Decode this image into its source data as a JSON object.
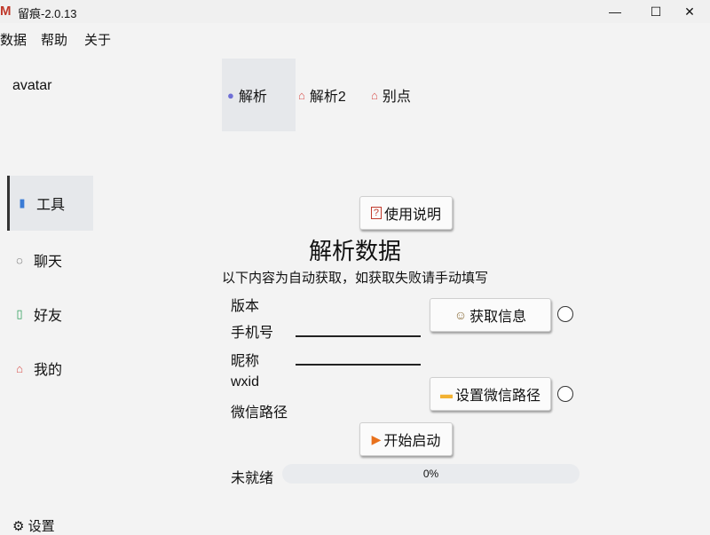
{
  "window": {
    "app_icon": "M",
    "title": "留痕-2.0.13",
    "minimize": "—",
    "maximize": "☐",
    "close": "✕"
  },
  "menu": [
    "数据",
    "帮助",
    "关于"
  ],
  "sidebar": {
    "avatar": "avatar",
    "items": [
      {
        "label": "工具",
        "icon": "tools-icon",
        "glyph": "▮"
      },
      {
        "label": "聊天",
        "icon": "chat-icon",
        "glyph": "◌"
      },
      {
        "label": "好友",
        "icon": "contacts-icon",
        "glyph": "▯"
      },
      {
        "label": "我的",
        "icon": "home-icon",
        "glyph": "⌂"
      }
    ],
    "settings": "设置",
    "settings_glyph": "⚙"
  },
  "tabs": [
    {
      "label": "解析",
      "glyph": "●"
    },
    {
      "label": "解析2",
      "glyph": "⌂"
    },
    {
      "label": "别点",
      "glyph": "⌂"
    }
  ],
  "main": {
    "help_button": "使用说明",
    "help_glyph": "?",
    "heading": "解析数据",
    "subtitle": "以下内容为自动获取，如获取失败请手动填写",
    "fields": {
      "version": "版本",
      "phone": "手机号",
      "nickname": "昵称",
      "wxid": "wxid",
      "wechat_path": "微信路径"
    },
    "get_info_button": "获取信息",
    "get_info_glyph": "☺",
    "set_path_button": "设置微信路径",
    "set_path_glyph": "▬",
    "start_button": "开始启动",
    "start_glyph": "▶",
    "status": "未就绪",
    "progress": "0%",
    "progress_value": 0
  },
  "colors": {
    "accent_active": "#e6e8eb",
    "progress_track": "#e9ebee",
    "start_icon": "#e8711c",
    "folder_icon": "#f2b233",
    "app_icon": "#c0392b"
  }
}
